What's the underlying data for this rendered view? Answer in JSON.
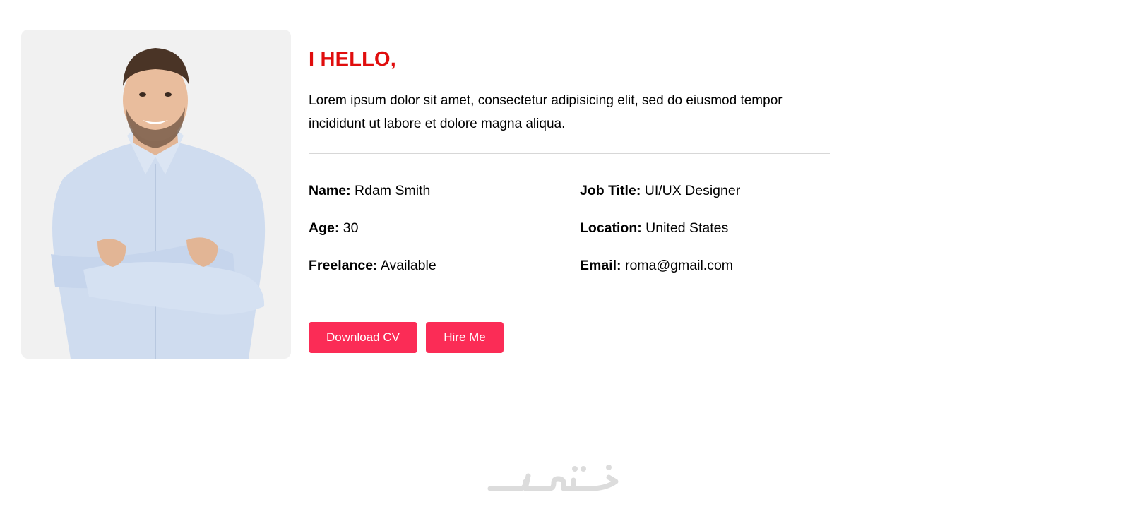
{
  "profile": {
    "greeting": "I HELLO,",
    "bio": "Lorem ipsum dolor sit amet, consectetur adipisicing elit, sed do eiusmod tempor incididunt ut labore et dolore magna aliqua.",
    "photo_icon": "person-photo",
    "details": {
      "name": {
        "label": "Name:",
        "value": "Rdam Smith"
      },
      "job_title": {
        "label": "Job Title:",
        "value": "UI/UX Designer"
      },
      "age": {
        "label": "Age:",
        "value": "30"
      },
      "location": {
        "label": "Location:",
        "value": "United States"
      },
      "freelance": {
        "label": "Freelance:",
        "value": "Available"
      },
      "email": {
        "label": "Email:",
        "value": "roma@gmail.com"
      }
    },
    "buttons": {
      "download_cv": "Download CV",
      "hire_me": "Hire Me"
    }
  },
  "watermark": {
    "text": "خمسات"
  },
  "colors": {
    "greeting": "#e00d0d",
    "button": "#fb2c56",
    "photo_bg": "#f1f1f1",
    "divider": "#d7d7d7",
    "watermark": "#dcdcdc"
  }
}
